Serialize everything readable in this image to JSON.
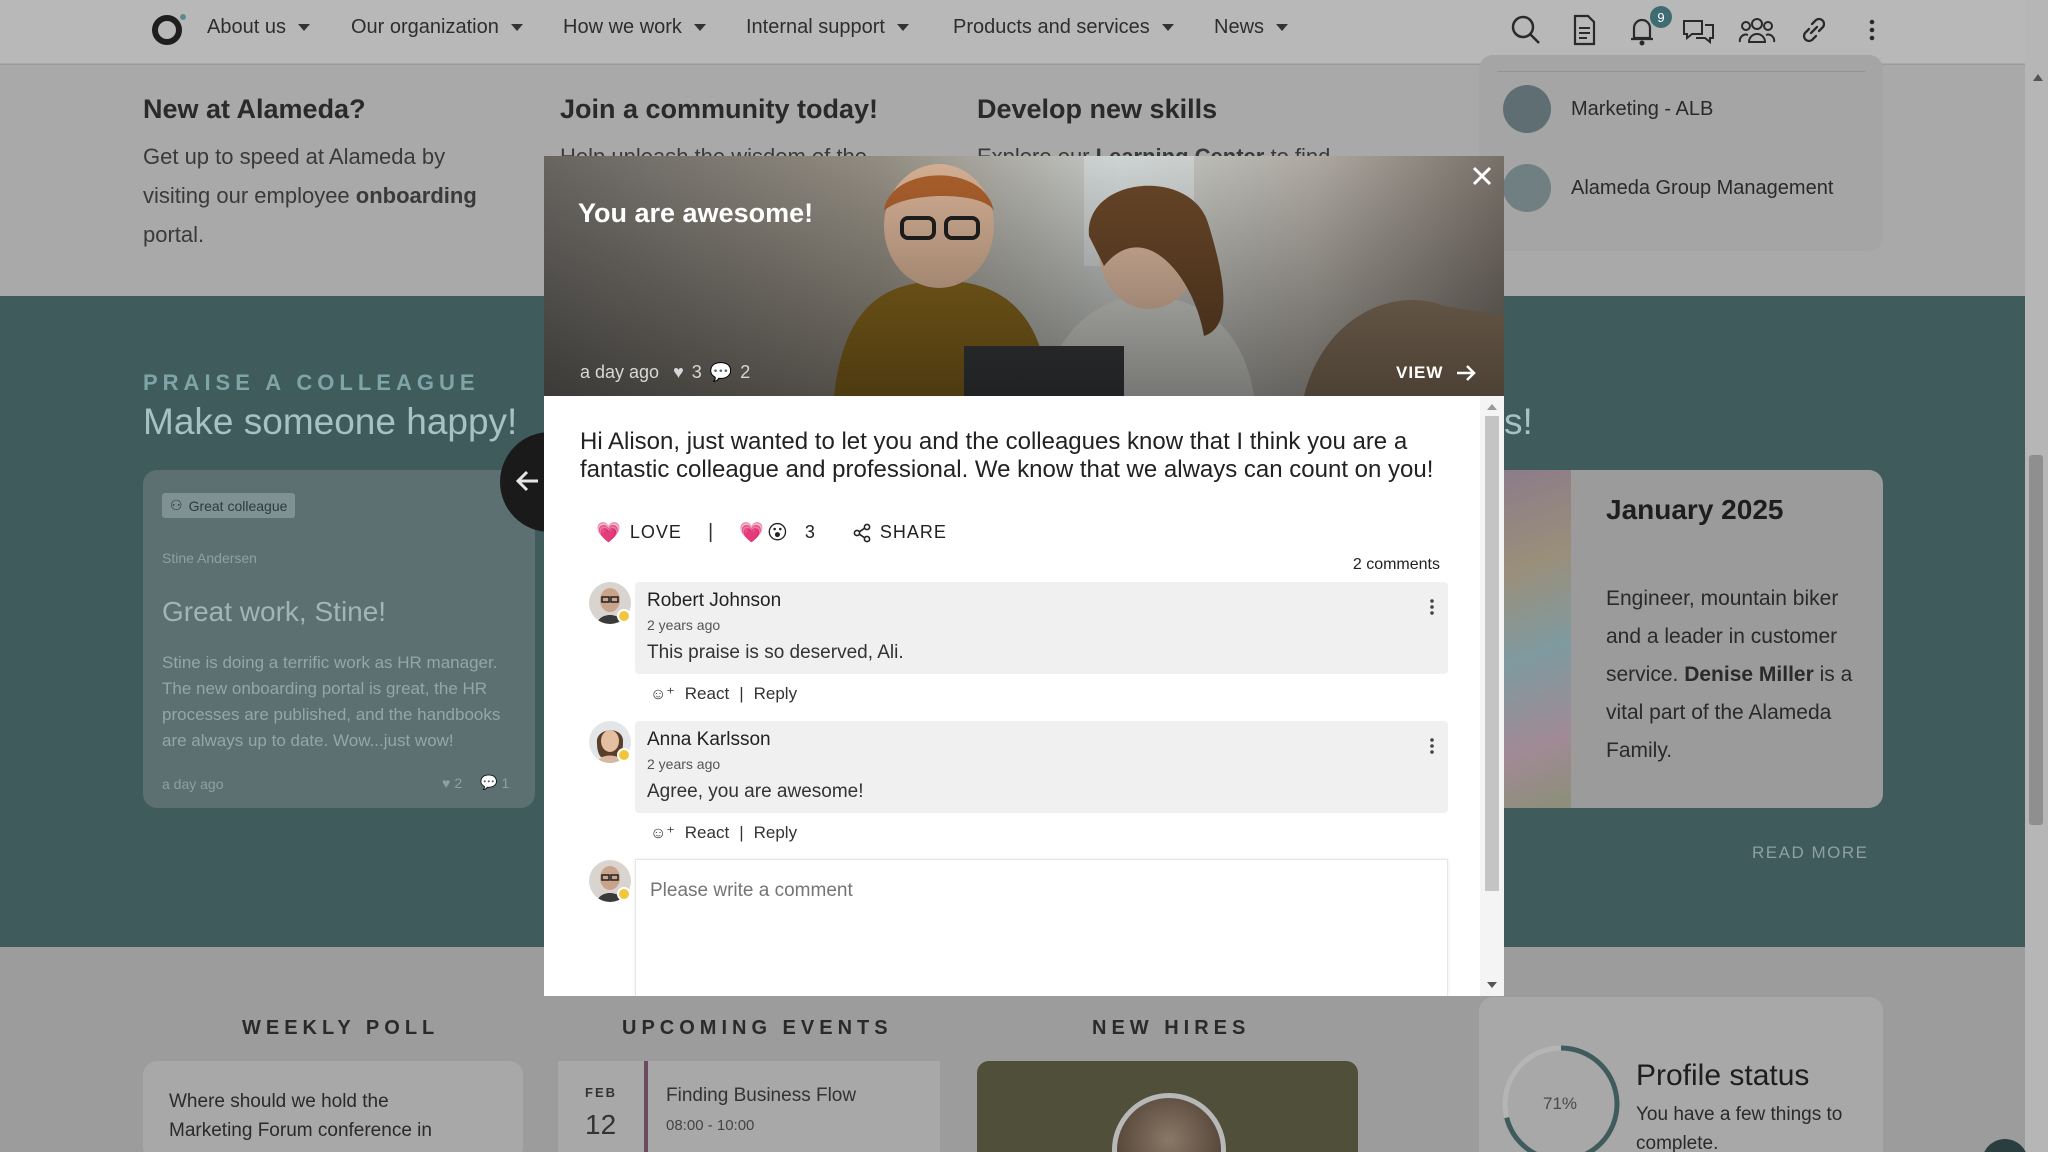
{
  "nav": {
    "items": [
      "About us",
      "Our organization",
      "How we work",
      "Internal support",
      "Products and services",
      "News"
    ],
    "notifications_count": "9"
  },
  "top": {
    "col1_title": "New at Alameda?",
    "col1_text_a": "Get up to speed at Alameda by",
    "col1_text_b": "visiting our employee",
    "col1_text_bold": "onboarding",
    "col1_text_c": "portal.",
    "col2_title": "Join a community today!",
    "col2_text": "Help unleash the wisdom of the",
    "col3_title": "Develop new skills",
    "col3_text_a": "Explore our",
    "col3_text_bold": "Learning Center",
    "col3_text_b": "to find",
    "groups": [
      "Marketing - ALB",
      "Alameda Group Management"
    ]
  },
  "praise": {
    "label": "PRAISE A COLLEAGUE",
    "title": "Make someone happy!",
    "title_right_fragment": "s!",
    "card": {
      "tag": "Great colleague",
      "author": "Stine Andersen",
      "headline": "Great work, Stine!",
      "body": "Stine is doing a terrific work as HR manager. The new onboarding portal is great, the HR processes are published, and the handbooks are always up to date. Wow...just wow!",
      "time": "a day ago",
      "likes": "2",
      "comments": "1"
    },
    "month": {
      "title": "January 2025",
      "text_a": "Engineer, mountain biker and a leader in customer service.",
      "text_bold": "Denise Miller",
      "text_b": "is a vital part of the Alameda Family.",
      "read_more": "READ MORE"
    }
  },
  "bottom": {
    "poll_head": "WEEKLY POLL",
    "poll_question": "Where should we hold the Marketing Forum conference in",
    "events_head": "UPCOMING EVENTS",
    "event_month": "FEB",
    "event_day": "12",
    "event_title": "Finding Business Flow",
    "event_time": "08:00 - 10:00",
    "hires_head": "NEW HIRES",
    "profile_pct": "71%",
    "profile_pct_value": 0.71,
    "profile_title": "Profile status",
    "profile_text": "You have a few things to complete."
  },
  "modal": {
    "hero_title": "You are awesome!",
    "hero_time": "a day ago",
    "hero_likes": "3",
    "hero_comments": "2",
    "view_label": "VIEW",
    "message": "Hi Alison, just wanted to let you and the colleagues know that I think you are a fantastic colleague and professional. We know that we always can count on you!",
    "love_label": "LOVE",
    "separator": "|",
    "reaction_count": "3",
    "share_label": "SHARE",
    "comments_count": "2 comments",
    "comments": [
      {
        "name": "Robert Johnson",
        "time": "2 years ago",
        "text": "This praise is so deserved, Ali."
      },
      {
        "name": "Anna Karlsson",
        "time": "2 years ago",
        "text": "Agree, you are awesome!"
      }
    ],
    "react_label": "React",
    "reply_label": "Reply",
    "comment_placeholder": "Please write a comment"
  },
  "colors": {
    "teal_dark": "#3f5b5c",
    "teal_label": "#7fa4a7",
    "love_pink": "#e8457d"
  }
}
